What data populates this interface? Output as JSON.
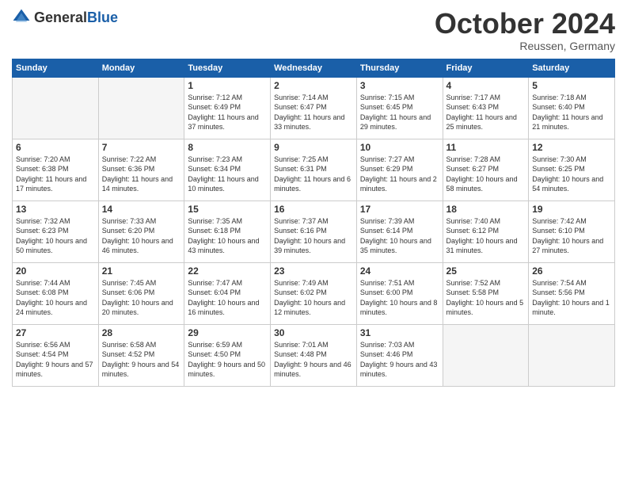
{
  "logo": {
    "general": "General",
    "blue": "Blue"
  },
  "header": {
    "month": "October 2024",
    "location": "Reussen, Germany"
  },
  "weekdays": [
    "Sunday",
    "Monday",
    "Tuesday",
    "Wednesday",
    "Thursday",
    "Friday",
    "Saturday"
  ],
  "weeks": [
    [
      {
        "day": "",
        "info": ""
      },
      {
        "day": "",
        "info": ""
      },
      {
        "day": "1",
        "sunrise": "Sunrise: 7:12 AM",
        "sunset": "Sunset: 6:49 PM",
        "daylight": "Daylight: 11 hours and 37 minutes."
      },
      {
        "day": "2",
        "sunrise": "Sunrise: 7:14 AM",
        "sunset": "Sunset: 6:47 PM",
        "daylight": "Daylight: 11 hours and 33 minutes."
      },
      {
        "day": "3",
        "sunrise": "Sunrise: 7:15 AM",
        "sunset": "Sunset: 6:45 PM",
        "daylight": "Daylight: 11 hours and 29 minutes."
      },
      {
        "day": "4",
        "sunrise": "Sunrise: 7:17 AM",
        "sunset": "Sunset: 6:43 PM",
        "daylight": "Daylight: 11 hours and 25 minutes."
      },
      {
        "day": "5",
        "sunrise": "Sunrise: 7:18 AM",
        "sunset": "Sunset: 6:40 PM",
        "daylight": "Daylight: 11 hours and 21 minutes."
      }
    ],
    [
      {
        "day": "6",
        "sunrise": "Sunrise: 7:20 AM",
        "sunset": "Sunset: 6:38 PM",
        "daylight": "Daylight: 11 hours and 17 minutes."
      },
      {
        "day": "7",
        "sunrise": "Sunrise: 7:22 AM",
        "sunset": "Sunset: 6:36 PM",
        "daylight": "Daylight: 11 hours and 14 minutes."
      },
      {
        "day": "8",
        "sunrise": "Sunrise: 7:23 AM",
        "sunset": "Sunset: 6:34 PM",
        "daylight": "Daylight: 11 hours and 10 minutes."
      },
      {
        "day": "9",
        "sunrise": "Sunrise: 7:25 AM",
        "sunset": "Sunset: 6:31 PM",
        "daylight": "Daylight: 11 hours and 6 minutes."
      },
      {
        "day": "10",
        "sunrise": "Sunrise: 7:27 AM",
        "sunset": "Sunset: 6:29 PM",
        "daylight": "Daylight: 11 hours and 2 minutes."
      },
      {
        "day": "11",
        "sunrise": "Sunrise: 7:28 AM",
        "sunset": "Sunset: 6:27 PM",
        "daylight": "Daylight: 10 hours and 58 minutes."
      },
      {
        "day": "12",
        "sunrise": "Sunrise: 7:30 AM",
        "sunset": "Sunset: 6:25 PM",
        "daylight": "Daylight: 10 hours and 54 minutes."
      }
    ],
    [
      {
        "day": "13",
        "sunrise": "Sunrise: 7:32 AM",
        "sunset": "Sunset: 6:23 PM",
        "daylight": "Daylight: 10 hours and 50 minutes."
      },
      {
        "day": "14",
        "sunrise": "Sunrise: 7:33 AM",
        "sunset": "Sunset: 6:20 PM",
        "daylight": "Daylight: 10 hours and 46 minutes."
      },
      {
        "day": "15",
        "sunrise": "Sunrise: 7:35 AM",
        "sunset": "Sunset: 6:18 PM",
        "daylight": "Daylight: 10 hours and 43 minutes."
      },
      {
        "day": "16",
        "sunrise": "Sunrise: 7:37 AM",
        "sunset": "Sunset: 6:16 PM",
        "daylight": "Daylight: 10 hours and 39 minutes."
      },
      {
        "day": "17",
        "sunrise": "Sunrise: 7:39 AM",
        "sunset": "Sunset: 6:14 PM",
        "daylight": "Daylight: 10 hours and 35 minutes."
      },
      {
        "day": "18",
        "sunrise": "Sunrise: 7:40 AM",
        "sunset": "Sunset: 6:12 PM",
        "daylight": "Daylight: 10 hours and 31 minutes."
      },
      {
        "day": "19",
        "sunrise": "Sunrise: 7:42 AM",
        "sunset": "Sunset: 6:10 PM",
        "daylight": "Daylight: 10 hours and 27 minutes."
      }
    ],
    [
      {
        "day": "20",
        "sunrise": "Sunrise: 7:44 AM",
        "sunset": "Sunset: 6:08 PM",
        "daylight": "Daylight: 10 hours and 24 minutes."
      },
      {
        "day": "21",
        "sunrise": "Sunrise: 7:45 AM",
        "sunset": "Sunset: 6:06 PM",
        "daylight": "Daylight: 10 hours and 20 minutes."
      },
      {
        "day": "22",
        "sunrise": "Sunrise: 7:47 AM",
        "sunset": "Sunset: 6:04 PM",
        "daylight": "Daylight: 10 hours and 16 minutes."
      },
      {
        "day": "23",
        "sunrise": "Sunrise: 7:49 AM",
        "sunset": "Sunset: 6:02 PM",
        "daylight": "Daylight: 10 hours and 12 minutes."
      },
      {
        "day": "24",
        "sunrise": "Sunrise: 7:51 AM",
        "sunset": "Sunset: 6:00 PM",
        "daylight": "Daylight: 10 hours and 8 minutes."
      },
      {
        "day": "25",
        "sunrise": "Sunrise: 7:52 AM",
        "sunset": "Sunset: 5:58 PM",
        "daylight": "Daylight: 10 hours and 5 minutes."
      },
      {
        "day": "26",
        "sunrise": "Sunrise: 7:54 AM",
        "sunset": "Sunset: 5:56 PM",
        "daylight": "Daylight: 10 hours and 1 minute."
      }
    ],
    [
      {
        "day": "27",
        "sunrise": "Sunrise: 6:56 AM",
        "sunset": "Sunset: 4:54 PM",
        "daylight": "Daylight: 9 hours and 57 minutes."
      },
      {
        "day": "28",
        "sunrise": "Sunrise: 6:58 AM",
        "sunset": "Sunset: 4:52 PM",
        "daylight": "Daylight: 9 hours and 54 minutes."
      },
      {
        "day": "29",
        "sunrise": "Sunrise: 6:59 AM",
        "sunset": "Sunset: 4:50 PM",
        "daylight": "Daylight: 9 hours and 50 minutes."
      },
      {
        "day": "30",
        "sunrise": "Sunrise: 7:01 AM",
        "sunset": "Sunset: 4:48 PM",
        "daylight": "Daylight: 9 hours and 46 minutes."
      },
      {
        "day": "31",
        "sunrise": "Sunrise: 7:03 AM",
        "sunset": "Sunset: 4:46 PM",
        "daylight": "Daylight: 9 hours and 43 minutes."
      },
      {
        "day": "",
        "info": ""
      },
      {
        "day": "",
        "info": ""
      }
    ]
  ]
}
